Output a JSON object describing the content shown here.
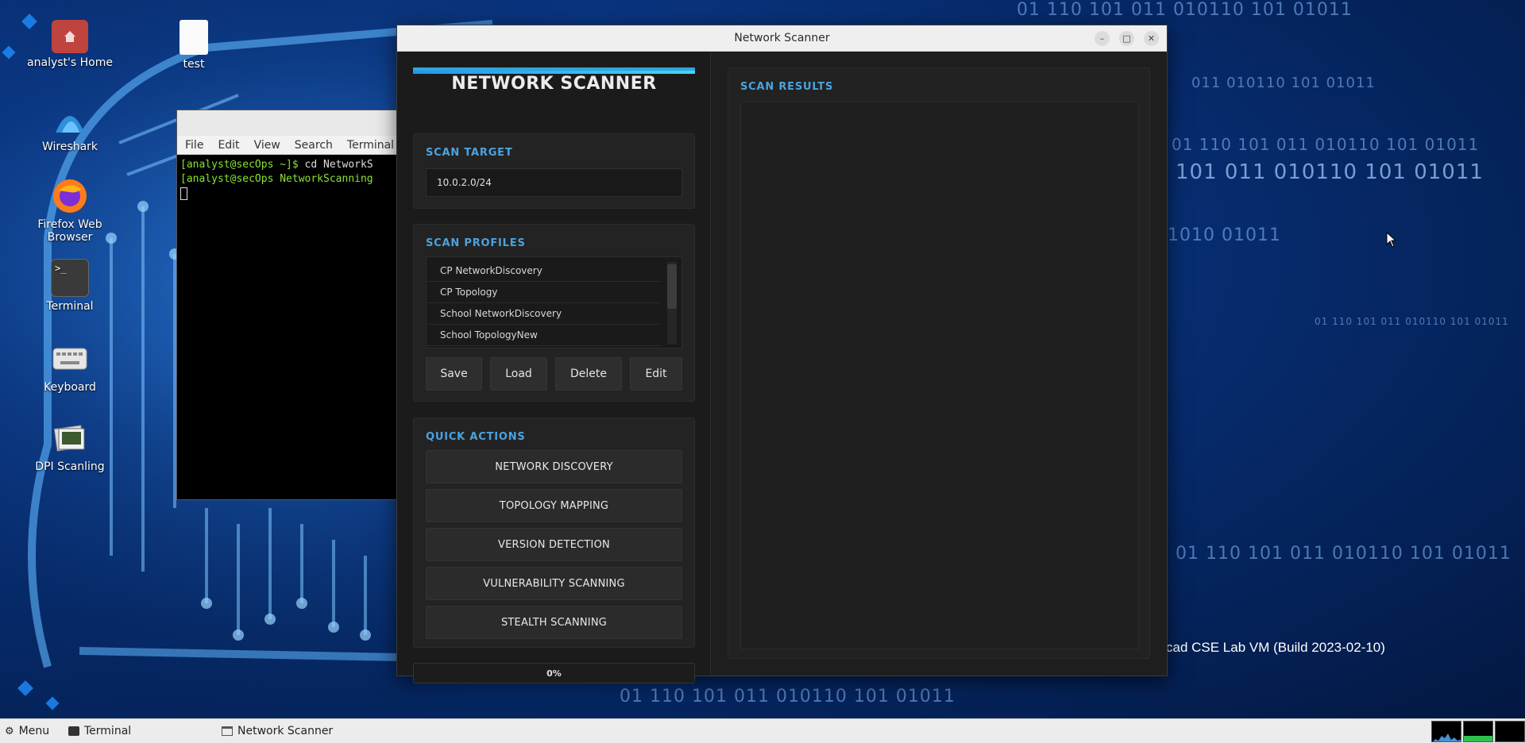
{
  "desktop": {
    "icons": [
      {
        "label": "analyst's Home",
        "icon": "home-folder-icon"
      },
      {
        "label": "test",
        "icon": "file-icon"
      },
      {
        "label": "Wireshark",
        "icon": "wireshark-icon"
      },
      {
        "label": "Firefox Web Browser",
        "icon": "firefox-icon"
      },
      {
        "label": "Terminal",
        "icon": "terminal-icon"
      },
      {
        "label": "Keyboard",
        "icon": "keyboard-icon"
      },
      {
        "label": "DPI Scanling",
        "icon": "photos-icon"
      }
    ],
    "watermark": "cad CSE Lab VM (Build 2023-02-10)",
    "binary_rows": [
      "01 110 101 011 010110 101 01011",
      "011 010110 101 01011",
      "01 110 101 011 010110 101 01011",
      "101 011 010110 101 01011",
      "01 110 101 011 010110 101 01011",
      "1010 01011",
      "01 110 101 011 010110 101 01011",
      "01 110 101 011 010110 101 01011"
    ]
  },
  "terminal": {
    "menu": [
      "File",
      "Edit",
      "View",
      "Search",
      "Terminal"
    ],
    "line1_prompt": "[analyst@secOps ~]$ ",
    "line1_cmd": "cd NetworkS",
    "line2_prompt": "[analyst@secOps NetworkScanning"
  },
  "window": {
    "title": "Network Scanner",
    "app_title": "NETWORK SCANNER",
    "scan_target": {
      "heading": "SCAN TARGET",
      "value": "10.0.2.0/24"
    },
    "scan_profiles": {
      "heading": "SCAN PROFILES",
      "items": [
        "CP NetworkDiscovery",
        "CP Topology",
        "School NetworkDiscovery",
        "School TopologyNew"
      ],
      "buttons": {
        "save": "Save",
        "load": "Load",
        "delete": "Delete",
        "edit": "Edit"
      }
    },
    "quick_actions": {
      "heading": "QUICK ACTIONS",
      "buttons": [
        "NETWORK DISCOVERY",
        "TOPOLOGY MAPPING",
        "VERSION DETECTION",
        "VULNERABILITY SCANNING",
        "STEALTH SCANNING"
      ]
    },
    "progress": {
      "text": "0%",
      "value": 0
    },
    "results": {
      "heading": "SCAN RESULTS",
      "content": ""
    }
  },
  "taskbar": {
    "menu": "Menu",
    "items": [
      "Terminal",
      "Network Scanner"
    ]
  },
  "colors": {
    "accent": "#4aa3df",
    "title_bar_gradient_start": "#2196f3",
    "title_bar_gradient_end": "#4fd1f0",
    "window_bg": "#1e1e1e"
  }
}
